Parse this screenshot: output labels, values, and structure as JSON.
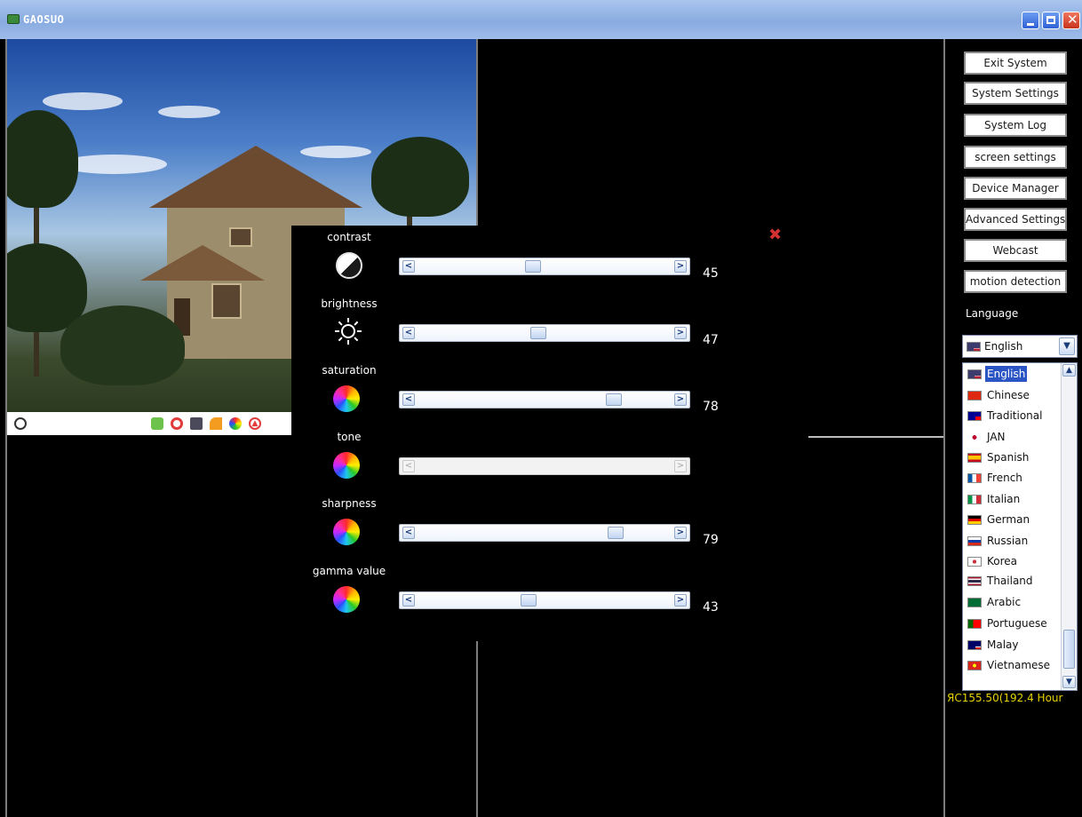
{
  "window": {
    "title": "GAOSUO",
    "controls": [
      "minimize",
      "maximize",
      "close"
    ]
  },
  "video_toolbar": {
    "icons": [
      "record-status-circle",
      "green-square-icon",
      "record-icon",
      "camera-icon",
      "rss-icon",
      "color-icon",
      "upload-icon"
    ]
  },
  "image_settings": {
    "controls": [
      {
        "label": "contrast",
        "value": "45",
        "level": 45,
        "enabled": true,
        "icon": "contrast-icon"
      },
      {
        "label": "brightness",
        "value": "47",
        "level": 47,
        "enabled": true,
        "icon": "sun-icon"
      },
      {
        "label": "saturation",
        "value": "78",
        "level": 78,
        "enabled": true,
        "icon": "color-wheel-icon"
      },
      {
        "label": "tone",
        "value": "",
        "level": null,
        "enabled": false,
        "icon": "color-wheel-icon"
      },
      {
        "label": "sharpness",
        "value": "79",
        "level": 79,
        "enabled": true,
        "icon": "color-wheel-icon"
      },
      {
        "label": "gamma value",
        "value": "43",
        "level": 43,
        "enabled": true,
        "icon": "color-wheel-icon"
      }
    ]
  },
  "sidebar": {
    "buttons": [
      "Exit System",
      "System Settings",
      "System Log",
      "screen settings",
      "Device Manager",
      "Advanced Settings",
      "Webcast",
      "motion detection"
    ],
    "language_label": "Language",
    "language_selected": "English",
    "languages": [
      {
        "name": "English",
        "flag": "us",
        "selected": true
      },
      {
        "name": "Chinese",
        "flag": "cn"
      },
      {
        "name": "Traditional",
        "flag": "tw"
      },
      {
        "name": "JAN",
        "flag": "jp"
      },
      {
        "name": "Spanish",
        "flag": "es"
      },
      {
        "name": "French",
        "flag": "fr"
      },
      {
        "name": "Italian",
        "flag": "it"
      },
      {
        "name": "German",
        "flag": "de"
      },
      {
        "name": "Russian",
        "flag": "ru"
      },
      {
        "name": "Korea",
        "flag": "kr"
      },
      {
        "name": "Thailand",
        "flag": "th"
      },
      {
        "name": "Arabic",
        "flag": "sa"
      },
      {
        "name": "Portuguese",
        "flag": "pt"
      },
      {
        "name": "Malay",
        "flag": "my"
      },
      {
        "name": "Vietnamese",
        "flag": "vn"
      }
    ],
    "status_text": "ЯС155.50(192.4 Hour"
  },
  "colors": {
    "titlebar": "#89abe0",
    "selection": "#2b55c5",
    "status_text": "#e6d200",
    "close_x": "#d03232"
  }
}
